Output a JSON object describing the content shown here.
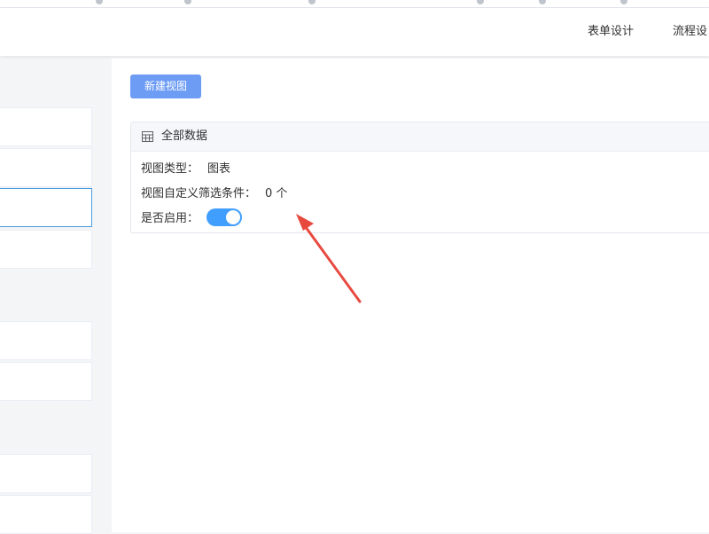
{
  "header": {
    "tabs": [
      {
        "label": "表单设计"
      },
      {
        "label": "流程设"
      }
    ]
  },
  "main": {
    "new_view_button": "新建视图",
    "card": {
      "icon": "table-icon",
      "title": "全部数据",
      "view_type_label": "视图类型：",
      "view_type_value": "图表",
      "filter_label": "视图自定义筛选条件：",
      "filter_value": "0 个",
      "enabled_label": "是否启用：",
      "enabled": true
    }
  },
  "annotation": {
    "type": "red-arrow",
    "color": "#e8493f"
  },
  "colors": {
    "primary_button": "#6d9cf5",
    "switch_on": "#409eff",
    "active_border": "#4a9be0"
  }
}
